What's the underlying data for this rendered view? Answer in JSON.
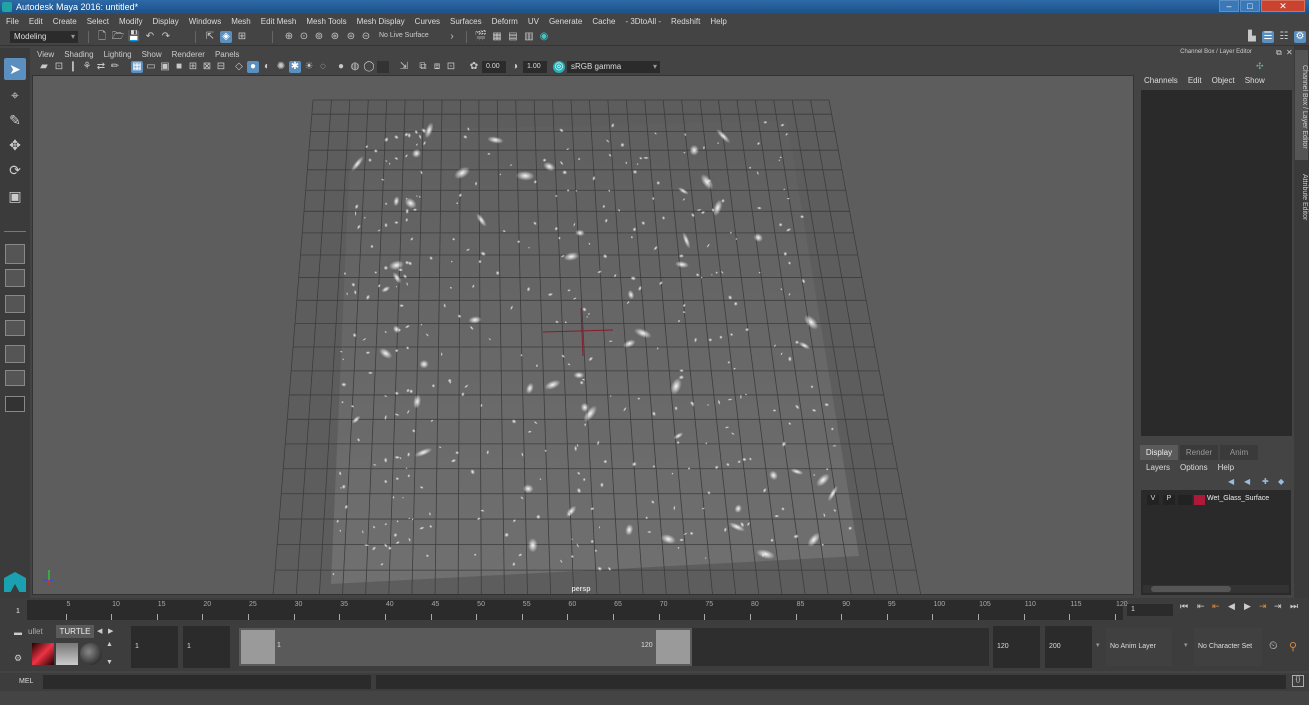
{
  "titlebar": {
    "title": "Autodesk Maya 2016: untitled*"
  },
  "window_controls": {
    "minimize": "–",
    "maximize": "□",
    "close": "✕"
  },
  "menubar": {
    "items": [
      "File",
      "Edit",
      "Create",
      "Select",
      "Modify",
      "Display",
      "Windows",
      "Mesh",
      "Edit Mesh",
      "Mesh Tools",
      "Mesh Display",
      "Curves",
      "Surfaces",
      "Deform",
      "UV",
      "Generate",
      "Cache",
      "- 3DtoAll -",
      "Redshift",
      "Help"
    ]
  },
  "statusline": {
    "menuset": "Modeling",
    "live_surface": "No Live Surface"
  },
  "panel": {
    "menu": [
      "View",
      "Shading",
      "Lighting",
      "Show",
      "Renderer",
      "Panels"
    ],
    "exposure": "0.00",
    "gamma": "1.00",
    "color_space": "sRGB gamma"
  },
  "viewport": {
    "camera_label": "persp",
    "object_name": "Wet_Glass_Surface"
  },
  "channel_box": {
    "title": "Channel Box / Layer Editor",
    "menu": [
      "Channels",
      "Edit",
      "Object",
      "Show"
    ]
  },
  "side_tabs": [
    "Channel Box / Layer Editor",
    "Attribute Editor"
  ],
  "layer_editor": {
    "tabs": [
      "Display",
      "Render",
      "Anim"
    ],
    "active_tab": "Display",
    "menu": [
      "Layers",
      "Options",
      "Help"
    ],
    "layers": [
      {
        "visible": "V",
        "playback": "P",
        "color": "#b0183a",
        "name": "Wet_Glass_Surface"
      }
    ]
  },
  "time_slider": {
    "start_label": "1",
    "ticks": [
      "5",
      "10",
      "15",
      "20",
      "25",
      "30",
      "35",
      "40",
      "45",
      "50",
      "55",
      "60",
      "65",
      "70",
      "75",
      "80",
      "85",
      "90",
      "95",
      "100",
      "105",
      "110",
      "115",
      "120"
    ],
    "current_frame": "1"
  },
  "range_slider": {
    "shelf_tabs": [
      "ullet",
      "TURTLE"
    ],
    "active_shelf": "TURTLE",
    "start_time": "1",
    "playback_start": "1",
    "range_start_label": "1",
    "range_end_label": "120",
    "playback_end": "120",
    "end_time": "200",
    "anim_layer": "No Anim Layer",
    "character_set": "No Character Set"
  },
  "command_line": {
    "label": "MEL",
    "value": "",
    "result": ""
  },
  "transport": {
    "buttons": [
      "go-to-start",
      "step-back-key",
      "step-back",
      "play-back",
      "play-forward",
      "step-forward-key",
      "step-forward",
      "go-to-end"
    ]
  }
}
